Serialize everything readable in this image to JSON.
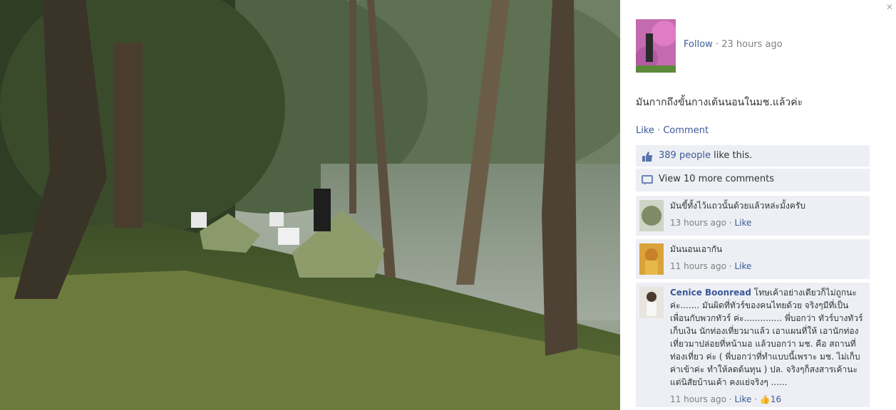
{
  "post": {
    "follow_label": "Follow",
    "separator": "·",
    "time": "23 hours ago",
    "caption": "มันกากถึงขั้นกางเต้นนอนในมช.แล้วค่ะ"
  },
  "actions": {
    "like": "Like",
    "comment": "Comment"
  },
  "likes": {
    "count": "389 people",
    "suffix": " like this."
  },
  "more_comments": "View 10 more comments",
  "comments": [
    {
      "author": "",
      "text": "มันขี้ทั้งไว้แถวนั้นด้วยแล้วหล่ะมั้งครับ",
      "time": "13 hours ago",
      "like": "Like"
    },
    {
      "author": "",
      "text": "มันนอนเอากัน",
      "time": "11 hours ago",
      "like": "Like"
    },
    {
      "author": "Cenice Boonread",
      "text": "โทษเค้าอย่างเดียวก็ไม่ถูกนะค่ะ....... มันผิดที่ทัวร์ของคนไทยด้วย จริงๆมีที่เป็นเพื่อนกับพวกทัวร์ ค่ะ.............. พี่บอกว่า ทัวร์บางทัวร์เก็บเงิน นักท่องเที่ยวมาแล้ว เอาแผนที่ให้ เอานักท่องเที่ยวมาปล่อยที่หน้ามอ แล้วบอกว่า มช. คือ สถานที่ท่องเที่ยว ค่ะ ( พี่บอกว่าที่ทำแบบนี้เพราะ มช. ไม่เก็บค่าเข้าค่ะ ทำให้ลดต้นทุน ) ปล. จริงๆก็สงสารเค้านะ แต่นิสัยบ้านเค้า คงแย่จริงๆ ......",
      "time": "11 hours ago",
      "like": "Like",
      "like_count": "16"
    }
  ],
  "colors": {
    "link": "#3b5998",
    "panel_bg": "#edeff4",
    "meta": "#808080"
  }
}
